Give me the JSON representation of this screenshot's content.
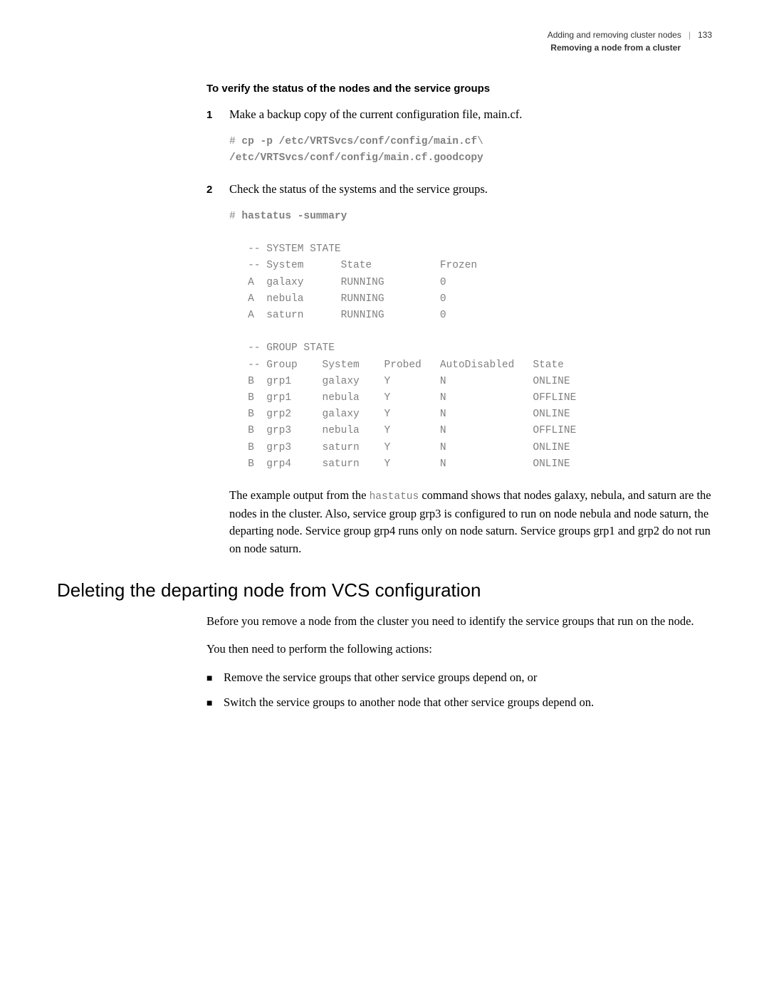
{
  "header": {
    "chapter": "Adding and removing cluster nodes",
    "page_number": "133",
    "section": "Removing a node from a cluster"
  },
  "procedure": {
    "title": "To verify the status of the nodes and the service groups",
    "step1": {
      "num": "1",
      "text": "Make a backup copy of the current configuration file, main.cf.",
      "code_prompt": "# ",
      "code_line1": "cp -p /etc/VRTSvcs/conf/config/main.cf",
      "code_backslash": "\\",
      "code_line2": "/etc/VRTSvcs/conf/config/main.cf.goodcopy"
    },
    "step2": {
      "num": "2",
      "text": "Check the status of the systems and the service groups.",
      "code_prompt": "# ",
      "code_cmd": "hastatus -summary",
      "system_state_header": "-- SYSTEM STATE",
      "system_state_cols": "-- System      State           Frozen",
      "sys_row_a1": "A  galaxy      RUNNING         0",
      "sys_row_a2": "A  nebula      RUNNING         0",
      "sys_row_a3": "A  saturn      RUNNING         0",
      "group_state_header": "-- GROUP STATE",
      "group_state_cols": "-- Group    System    Probed   AutoDisabled   State",
      "grp_row_b1": "B  grp1     galaxy    Y        N              ONLINE",
      "grp_row_b2": "B  grp1     nebula    Y        N              OFFLINE",
      "grp_row_b3": "B  grp2     galaxy    Y        N              ONLINE",
      "grp_row_b4": "B  grp3     nebula    Y        N              OFFLINE",
      "grp_row_b5": "B  grp3     saturn    Y        N              ONLINE",
      "grp_row_b6": "B  grp4     saturn    Y        N              ONLINE",
      "para_pre": "The example output from the ",
      "para_code": "hastatus",
      "para_post": " command shows that nodes galaxy, nebula, and saturn are the nodes in the cluster. Also, service group grp3 is configured to run on node nebula and node saturn, the departing node. Service group grp4 runs only on node saturn. Service groups grp1 and grp2 do not run on node saturn."
    }
  },
  "section2": {
    "heading": "Deleting the departing node from VCS configuration",
    "para1": "Before you remove a node from the cluster you need to identify the service groups that run on the node.",
    "para2": "You then need to perform the following actions:",
    "bullets": {
      "b1": "Remove the service groups that other service groups depend on, or",
      "b2": "Switch the service groups to another node that other service groups depend on."
    }
  }
}
